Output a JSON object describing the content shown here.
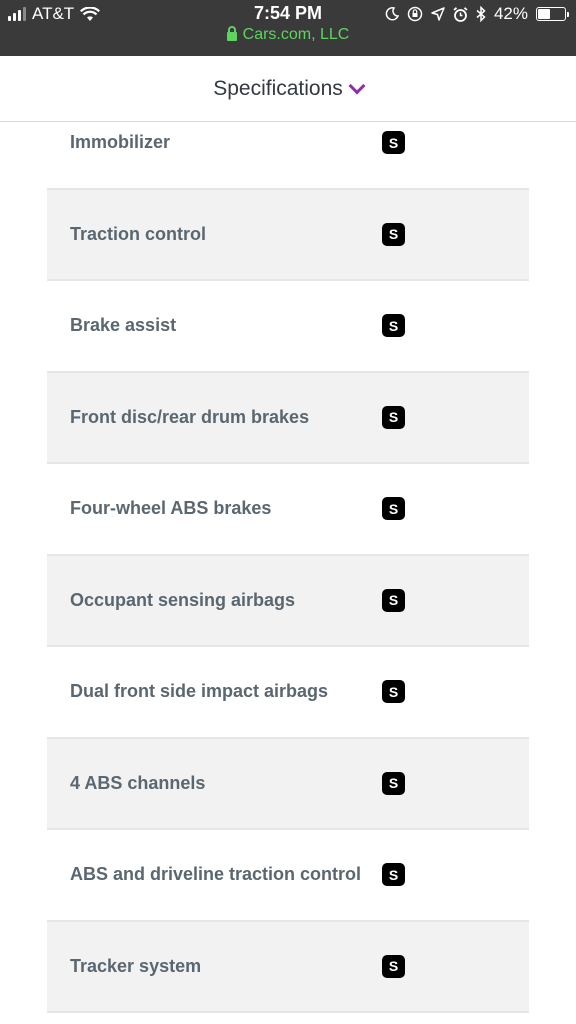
{
  "status_bar": {
    "carrier": "AT&T",
    "time": "7:54 PM",
    "site": "Cars.com, LLC",
    "battery_percent_text": "42%",
    "battery_level": 0.42,
    "icons": [
      "signal-icon",
      "wifi-icon",
      "lock-icon",
      "moon-icon",
      "orientation-lock-icon",
      "location-icon",
      "alarm-icon",
      "bluetooth-icon",
      "battery-icon"
    ]
  },
  "header": {
    "title": "Specifications",
    "accent_color": "#8f2fa8"
  },
  "specs": [
    {
      "label": "Immobilizer",
      "badge": "S"
    },
    {
      "label": "Traction control",
      "badge": "S"
    },
    {
      "label": "Brake assist",
      "badge": "S"
    },
    {
      "label": "Front disc/rear drum brakes",
      "badge": "S"
    },
    {
      "label": "Four-wheel ABS brakes",
      "badge": "S"
    },
    {
      "label": "Occupant sensing airbags",
      "badge": "S"
    },
    {
      "label": "Dual front side impact airbags",
      "badge": "S"
    },
    {
      "label": "4 ABS channels",
      "badge": "S"
    },
    {
      "label": "ABS and driveline traction control",
      "badge": "S"
    },
    {
      "label": "Tracker system",
      "badge": "S"
    }
  ]
}
